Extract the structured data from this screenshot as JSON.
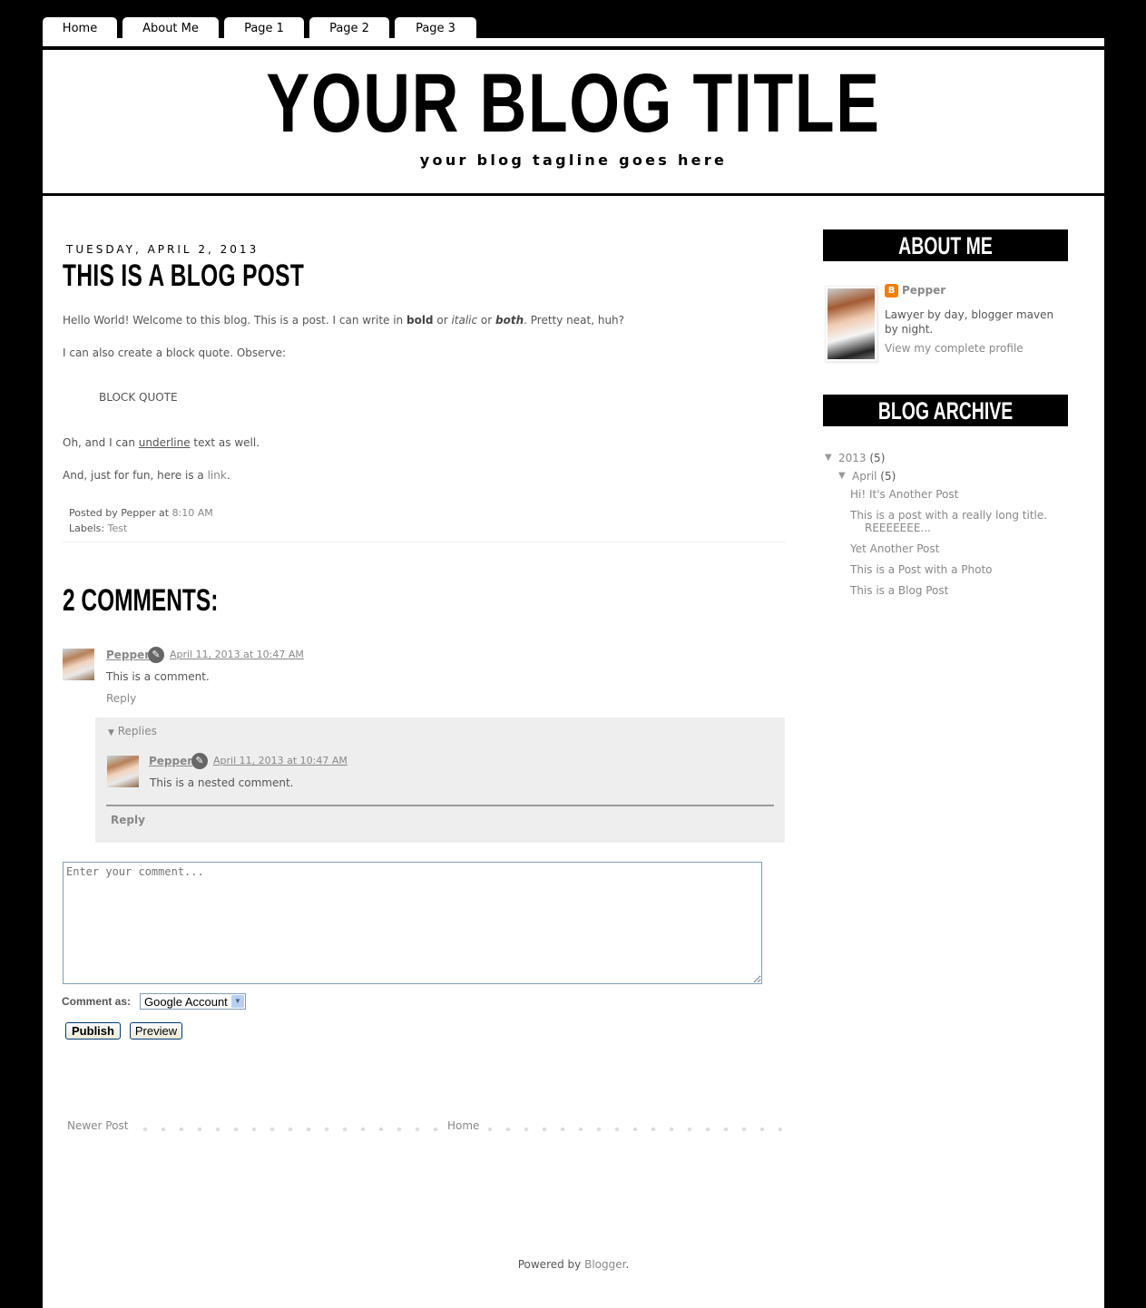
{
  "nav": {
    "tabs": [
      {
        "label": "Home"
      },
      {
        "label": "About Me"
      },
      {
        "label": "Page 1"
      },
      {
        "label": "Page 2"
      },
      {
        "label": "Page 3"
      }
    ]
  },
  "header": {
    "title": "YOUR BLOG TITLE",
    "tagline": "your blog tagline goes here"
  },
  "post": {
    "date": "TUESDAY, APRIL 2, 2013",
    "title": "THIS IS A BLOG POST",
    "p1": {
      "a": "Hello World!  Welcome to this blog.  This is a post.  I can write in ",
      "bold": "bold",
      "b": " or ",
      "italic": "italic",
      "c": " or ",
      "both": "both",
      "d": ".  Pretty neat, huh?"
    },
    "p2": "I can also create a block quote.  Observe:",
    "blockquote": "BLOCK QUOTE",
    "p3": {
      "a": "Oh, and I can ",
      "underline": "underline",
      "b": " text as well."
    },
    "p4": {
      "a": "And, just for fun, here is a ",
      "link": "link",
      "b": "."
    },
    "footer": {
      "posted_by_prefix": "Posted by Pepper at ",
      "time": "8:10 AM",
      "labels_prefix": "Labels: ",
      "label": "Test"
    }
  },
  "comments": {
    "title": "2 COMMENTS:",
    "items": [
      {
        "author": "Pepper",
        "date": "April 11, 2013 at 10:47 AM",
        "text": "This is a comment.",
        "reply": "Reply"
      }
    ],
    "replies": {
      "toggle_label": "Replies",
      "items": [
        {
          "author": "Pepper",
          "date": "April 11, 2013 at 10:47 AM",
          "text": "This is a nested comment."
        }
      ],
      "reply": "Reply"
    },
    "form": {
      "placeholder": "Enter your comment...",
      "comment_as_label": "Comment as:",
      "comment_as_value": "Google Account",
      "publish": "Publish",
      "preview": "Preview"
    }
  },
  "pager": {
    "newer": "Newer Post",
    "home": "Home"
  },
  "sidebar": {
    "about": {
      "title": "ABOUT ME",
      "name": "Pepper",
      "description": "Lawyer by day, blogger maven by night.",
      "profile_link": "View my complete profile"
    },
    "archive": {
      "title": "BLOG ARCHIVE",
      "year": "2013",
      "year_count": "(5)",
      "month": "April",
      "month_count": "(5)",
      "posts": [
        {
          "line1": "This is a post with a really long title.",
          "line2": "REEEEEEE..."
        },
        {
          "title": "Hi! It's Another Post"
        },
        {
          "title": "Yet Another Post"
        },
        {
          "title": "This is a Post with a Photo"
        },
        {
          "title": "This is a Blog Post"
        }
      ]
    }
  },
  "footer": {
    "powered_prefix": "Powered by ",
    "powered_link": "Blogger",
    "powered_suffix": "."
  },
  "colors": {
    "background": "#000000",
    "content": "#ffffff",
    "link": "#888888",
    "text": "#555555",
    "blogger_orange": "#f57d00",
    "replies_bg": "#eeeeee"
  }
}
